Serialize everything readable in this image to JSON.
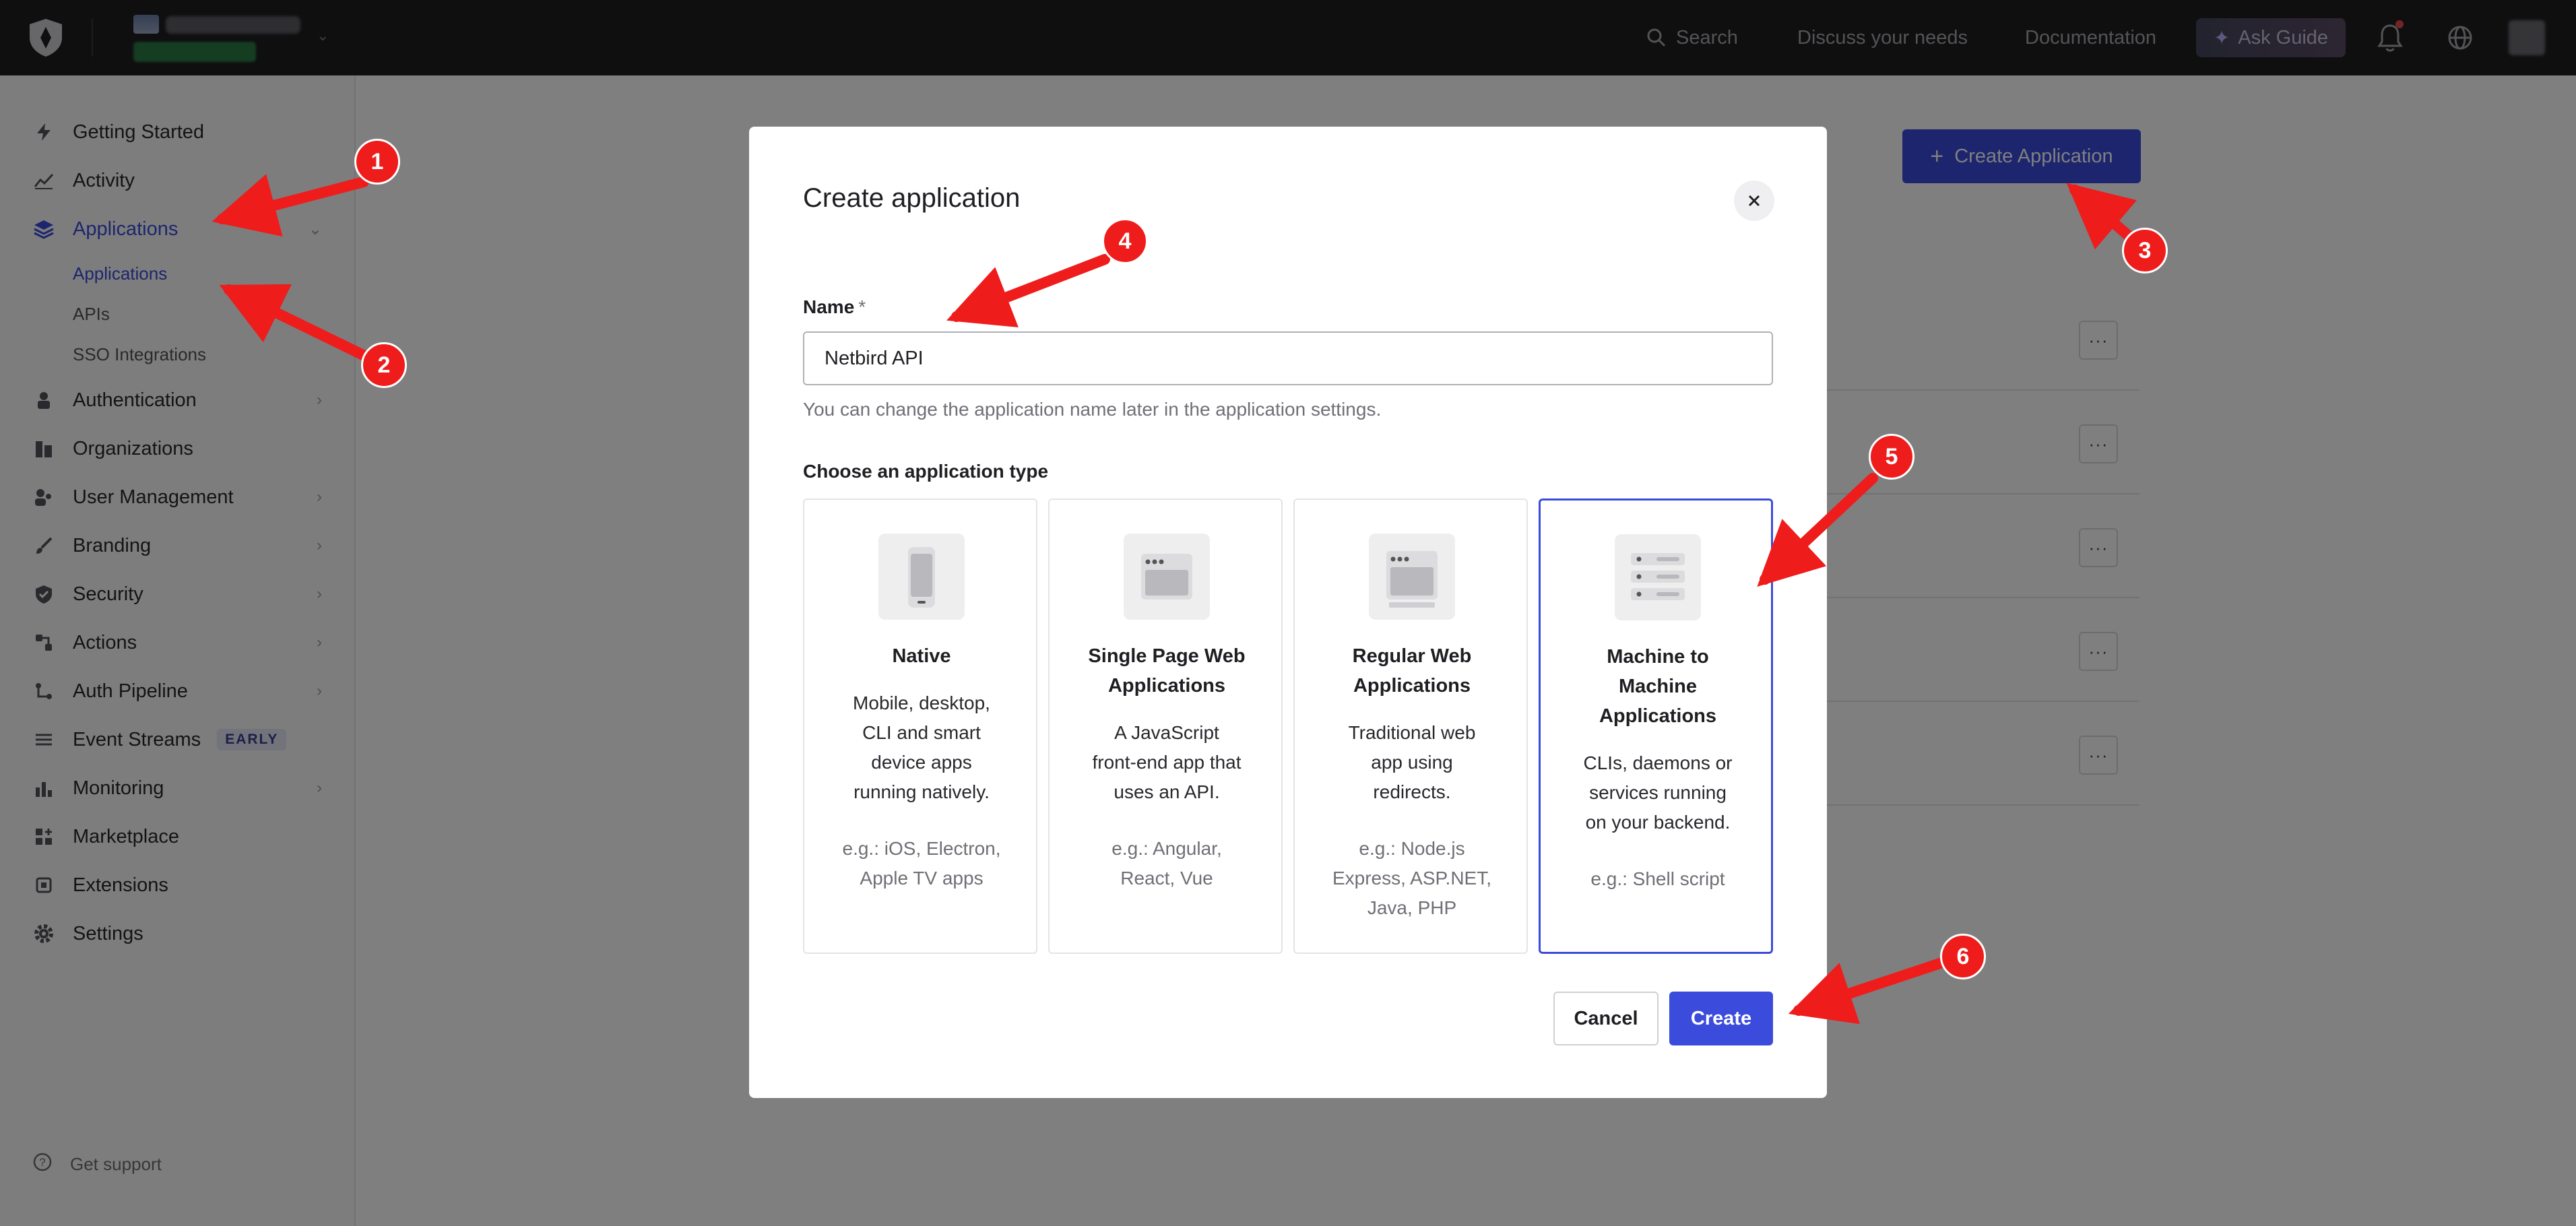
{
  "topbar": {
    "search_label": "Search",
    "discuss_label": "Discuss your needs",
    "docs_label": "Documentation",
    "ask_guide_label": "Ask Guide"
  },
  "sidebar": {
    "items": [
      {
        "label": "Getting Started"
      },
      {
        "label": "Activity"
      },
      {
        "label": "Applications"
      },
      {
        "label": "Authentication"
      },
      {
        "label": "Organizations"
      },
      {
        "label": "User Management"
      },
      {
        "label": "Branding"
      },
      {
        "label": "Security"
      },
      {
        "label": "Actions"
      },
      {
        "label": "Auth Pipeline"
      },
      {
        "label": "Event Streams",
        "badge": "EARLY"
      },
      {
        "label": "Monitoring"
      },
      {
        "label": "Marketplace"
      },
      {
        "label": "Extensions"
      },
      {
        "label": "Settings"
      }
    ],
    "subitems": [
      {
        "label": "Applications"
      },
      {
        "label": "APIs"
      },
      {
        "label": "SSO Integrations"
      }
    ],
    "support_label": "Get support",
    "collapse_glyph": "«"
  },
  "main": {
    "create_button_label": "Create Application",
    "row_menu_glyph": "···"
  },
  "modal": {
    "title": "Create application",
    "name_label": "Name",
    "required_marker": "*",
    "name_value": "Netbird API",
    "name_help": "You can change the application name later in the application settings.",
    "type_label": "Choose an application type",
    "types": [
      {
        "title_lines": [
          "Native"
        ],
        "desc_lines": [
          "Mobile, desktop,",
          "CLI and smart",
          "device apps",
          "running natively."
        ],
        "eg_lines": [
          "e.g.: iOS, Electron,",
          "Apple TV apps"
        ]
      },
      {
        "title_lines": [
          "Single Page Web",
          "Applications"
        ],
        "desc_lines": [
          "A JavaScript",
          "front-end app that",
          "uses an API."
        ],
        "eg_lines": [
          "e.g.: Angular,",
          "React, Vue"
        ]
      },
      {
        "title_lines": [
          "Regular Web",
          "Applications"
        ],
        "desc_lines": [
          "Traditional web",
          "app using",
          "redirects."
        ],
        "eg_lines": [
          "e.g.: Node.js",
          "Express, ASP.NET,",
          "Java, PHP"
        ]
      },
      {
        "title_lines": [
          "Machine to",
          "Machine",
          "Applications"
        ],
        "desc_lines": [
          "CLIs, daemons or",
          "services running",
          "on your backend."
        ],
        "eg_lines": [
          "e.g.: Shell script"
        ]
      }
    ],
    "selected_type_index": 3,
    "cancel_label": "Cancel",
    "create_label": "Create"
  },
  "annotations": [
    "1",
    "2",
    "3",
    "4",
    "5",
    "6"
  ],
  "colors": {
    "accent": "#3b4bdc",
    "topbar": "#1e1e21",
    "annotation": "#ef1c1c"
  }
}
